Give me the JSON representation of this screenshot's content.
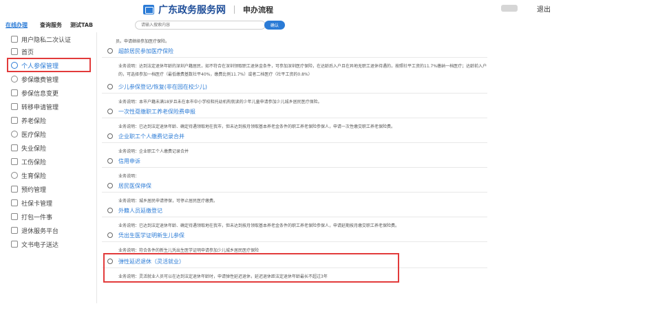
{
  "header": {
    "site_title": "广东政务服务网",
    "subtitle": "申办流程",
    "logout": "退出"
  },
  "nav": {
    "tabs": [
      "在线办理",
      "查询服务",
      "测试TAB"
    ],
    "search_placeholder": "请输入搜索内容",
    "confirm": "确认"
  },
  "sidebar": {
    "items": [
      {
        "label": "用户隐私二次认证",
        "icon": "home-icon"
      },
      {
        "label": "首页",
        "icon": "home-icon"
      },
      {
        "label": "个人参保管理",
        "icon": "user-icon",
        "active": true
      },
      {
        "label": "参保缴费管理",
        "icon": "coin-icon"
      },
      {
        "label": "参保信息变更",
        "icon": "edit-icon"
      },
      {
        "label": "转移申请管理",
        "icon": "transfer-icon"
      },
      {
        "label": "养老保险",
        "icon": "document-icon"
      },
      {
        "label": "医疗保险",
        "icon": "user-icon"
      },
      {
        "label": "失业保险",
        "icon": "document-icon"
      },
      {
        "label": "工伤保险",
        "icon": "document-icon"
      },
      {
        "label": "生育保险",
        "icon": "baby-icon"
      },
      {
        "label": "预约管理",
        "icon": "calendar-icon"
      },
      {
        "label": "社保卡管理",
        "icon": "card-icon"
      },
      {
        "label": "打包一件事",
        "icon": "card-icon"
      },
      {
        "label": "退休服务平台",
        "icon": "card-icon"
      },
      {
        "label": "文书电子送达",
        "icon": "document-icon"
      }
    ]
  },
  "content": {
    "fragment": "员。申请继续参加医疗保险。",
    "services": [
      {
        "title": "超龄居民参加医疗保险",
        "desc": "业务说明：达到法定退休年龄的深圳户籍居民，如不符合在深圳领取职工退休金条件，可参加深圳医疗保险，在达龄后入户且在异地无职工退休待遇的，按照社平工资的11.7%缴纳一档医疗；达龄前入户的，可选择参加一档医疗（最低缴费基数社平40%，缴费比例11.7%）或者二档医疗（社平工资的0.8%）"
      },
      {
        "title": "少儿参保登记/恢复(非在园在校少儿)",
        "desc": "业务说明：本市户籍未满18岁且未在本市中小学校和托幼机构就读的少年儿童申请参加少儿城乡居民医疗保险。"
      },
      {
        "title": "一次性趸缴职工养老保险费申报",
        "desc": "业务说明：已达到法定退休年龄、确定待遇领取地在我市，但未达到按月领取基本养老金条件的职工养老保险参保人，申请一次性缴交职工养老保险费。"
      },
      {
        "title": "企业职工个人缴费记录合并",
        "desc": "业务说明：企业职工个人缴费记录合并"
      },
      {
        "title": "信用申诉",
        "desc": "业务说明："
      },
      {
        "title": "居民医保停保",
        "desc": "业务说明：城乡居民申请停保，可停止居民医疗缴费。"
      },
      {
        "title": "外籍人员延缴登记",
        "desc": "业务说明：已达到法定退休年龄、确定待遇领取地在我市，但未达到按月领取基本养老金条件的职工养老保险参保人，申请延期按月缴交职工养老保险费。"
      },
      {
        "title": "凭出生医学证明新生儿参保",
        "desc": "业务说明：符合条件的新生儿凭出生医学证明申请参加少儿城乡居民医疗保险"
      },
      {
        "title": "弹性延迟退休（灵活就业）",
        "desc": "业务说明：灵活就业人员可以在达到法定退休年龄时，申请弹性延迟退休，延迟退休距法定退休年龄最长不超过3年"
      }
    ]
  },
  "colors": {
    "accent": "#2b7bd6",
    "highlight": "#e23a3a"
  }
}
